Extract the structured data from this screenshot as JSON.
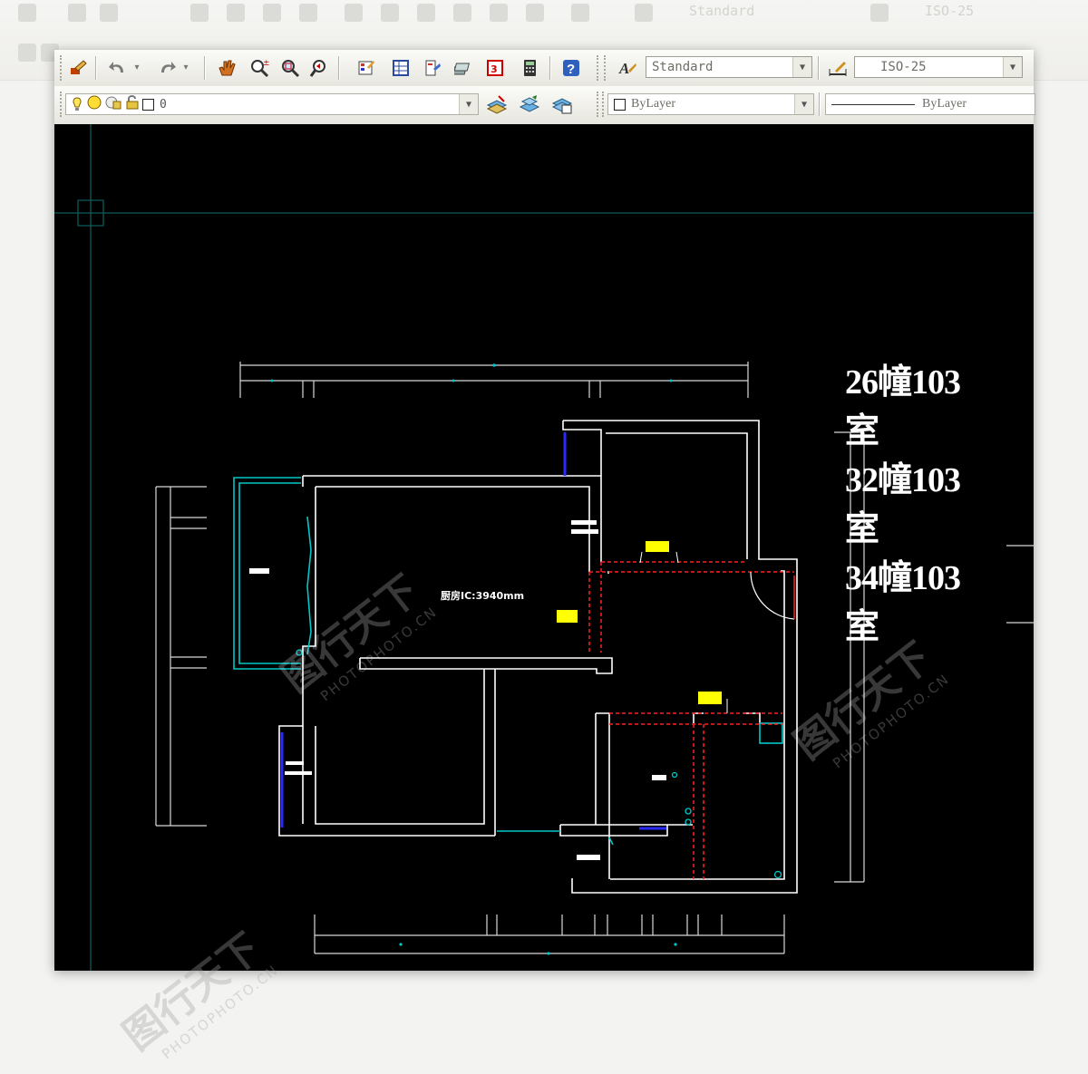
{
  "toolbar_top": {
    "text_style": "Standard",
    "dim_style": "ISO-25"
  },
  "toolbar_layers": {
    "current_layer": "0",
    "color": "ByLayer",
    "linetype": "ByLayer"
  },
  "drawing": {
    "titles": [
      "26幢103室",
      "32幢103室",
      "34幢103室"
    ],
    "room_label": "厨房IC:3940mm"
  },
  "watermark": {
    "cn": "图行天下",
    "en": "PHOTOPHOTO.CN"
  },
  "colors": {
    "canvas": "#000000",
    "walls": "#ffffff",
    "cyan": "#00c8c8",
    "red_dash": "#ff2020",
    "yellow_tag": "#ffff00",
    "blue_window": "#2a2aff"
  }
}
